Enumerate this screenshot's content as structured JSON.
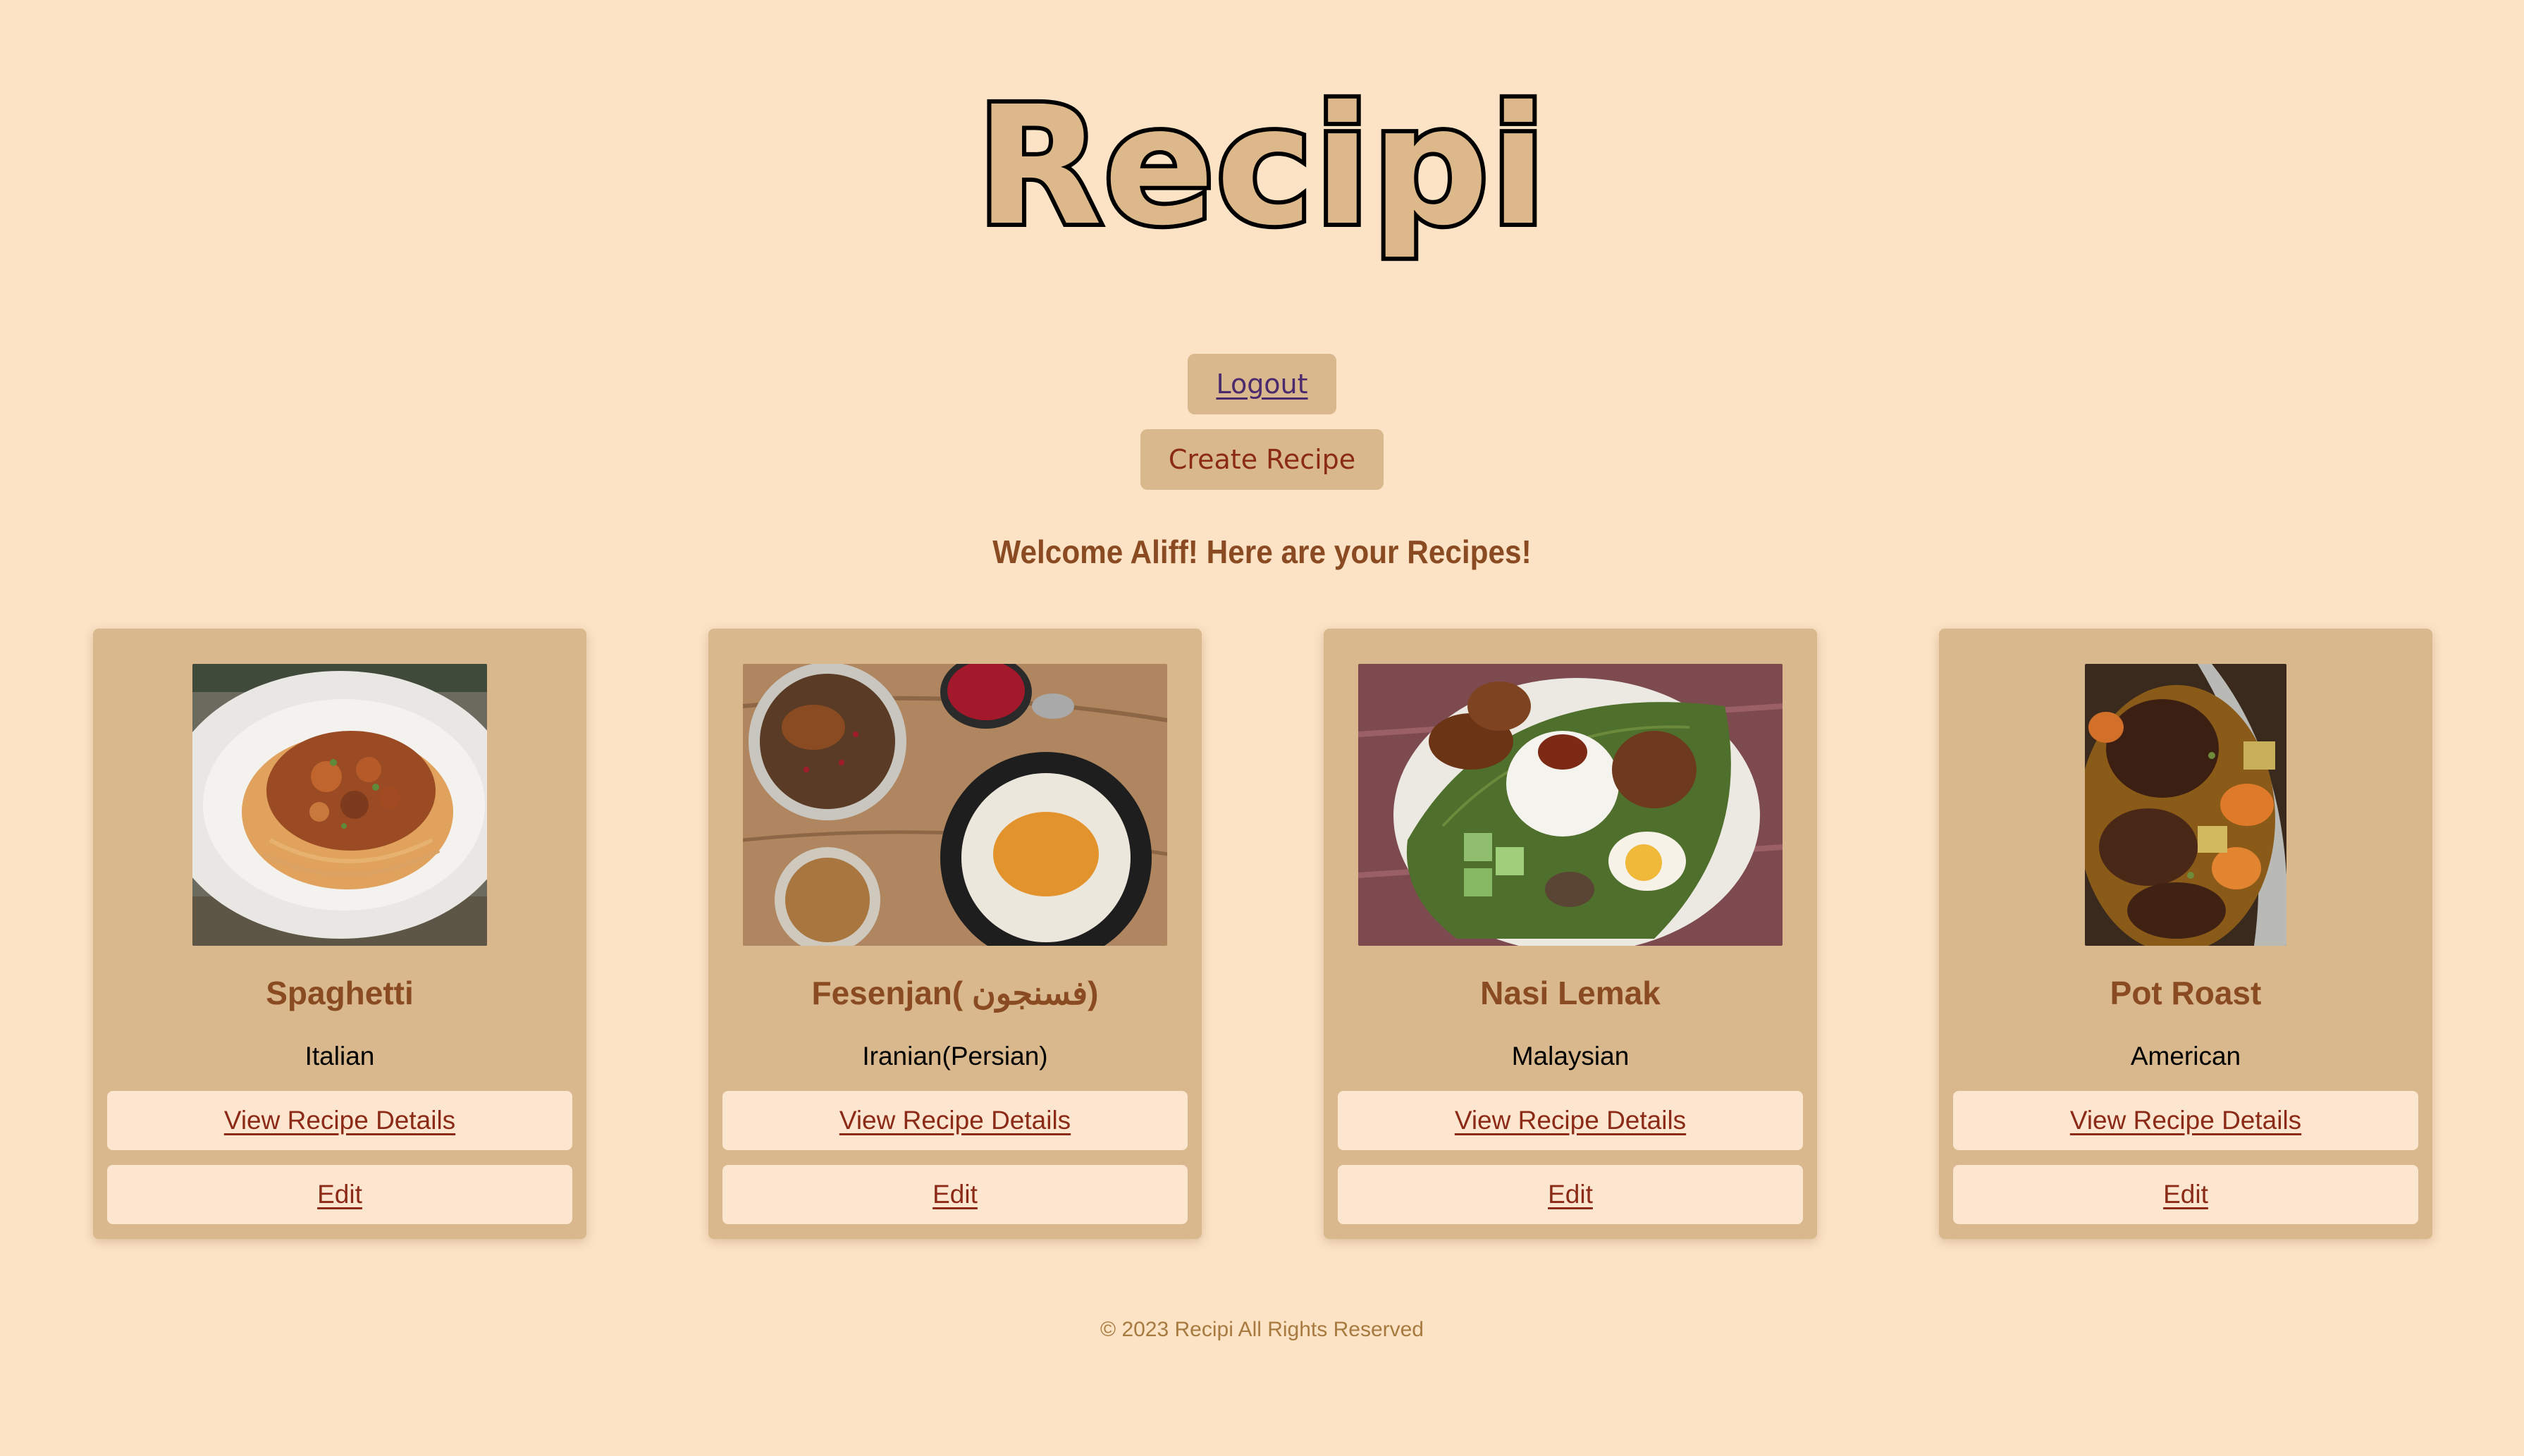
{
  "brand": {
    "logo_text": "Recipi"
  },
  "header": {
    "logout_label": "Logout",
    "create_label": "Create Recipe"
  },
  "welcome_text": "Welcome Aliff! Here are your Recipes!",
  "recipes": [
    {
      "title": "Spaghetti",
      "cuisine": "Italian",
      "view_label": "View Recipe Details",
      "edit_label": "Edit",
      "image": "spaghetti-photo"
    },
    {
      "title": "Fesenjan( فسنجون)",
      "cuisine": "Iranian(Persian)",
      "view_label": "View Recipe Details",
      "edit_label": "Edit",
      "image": "fesenjan-photo"
    },
    {
      "title": "Nasi Lemak",
      "cuisine": "Malaysian",
      "view_label": "View Recipe Details",
      "edit_label": "Edit",
      "image": "nasi-lemak-photo"
    },
    {
      "title": "Pot Roast",
      "cuisine": "American",
      "view_label": "View Recipe Details",
      "edit_label": "Edit",
      "image": "pot-roast-photo"
    }
  ],
  "footer": {
    "copyright": "© 2023 Recipi All Rights Reserved"
  },
  "colors": {
    "background": "#fce3c5",
    "card": "#d8b88c",
    "button_light": "#fde6cf",
    "heading_brown": "#8a4b23",
    "link_red": "#8c2a18",
    "logout_purple": "#4b2a6e"
  }
}
